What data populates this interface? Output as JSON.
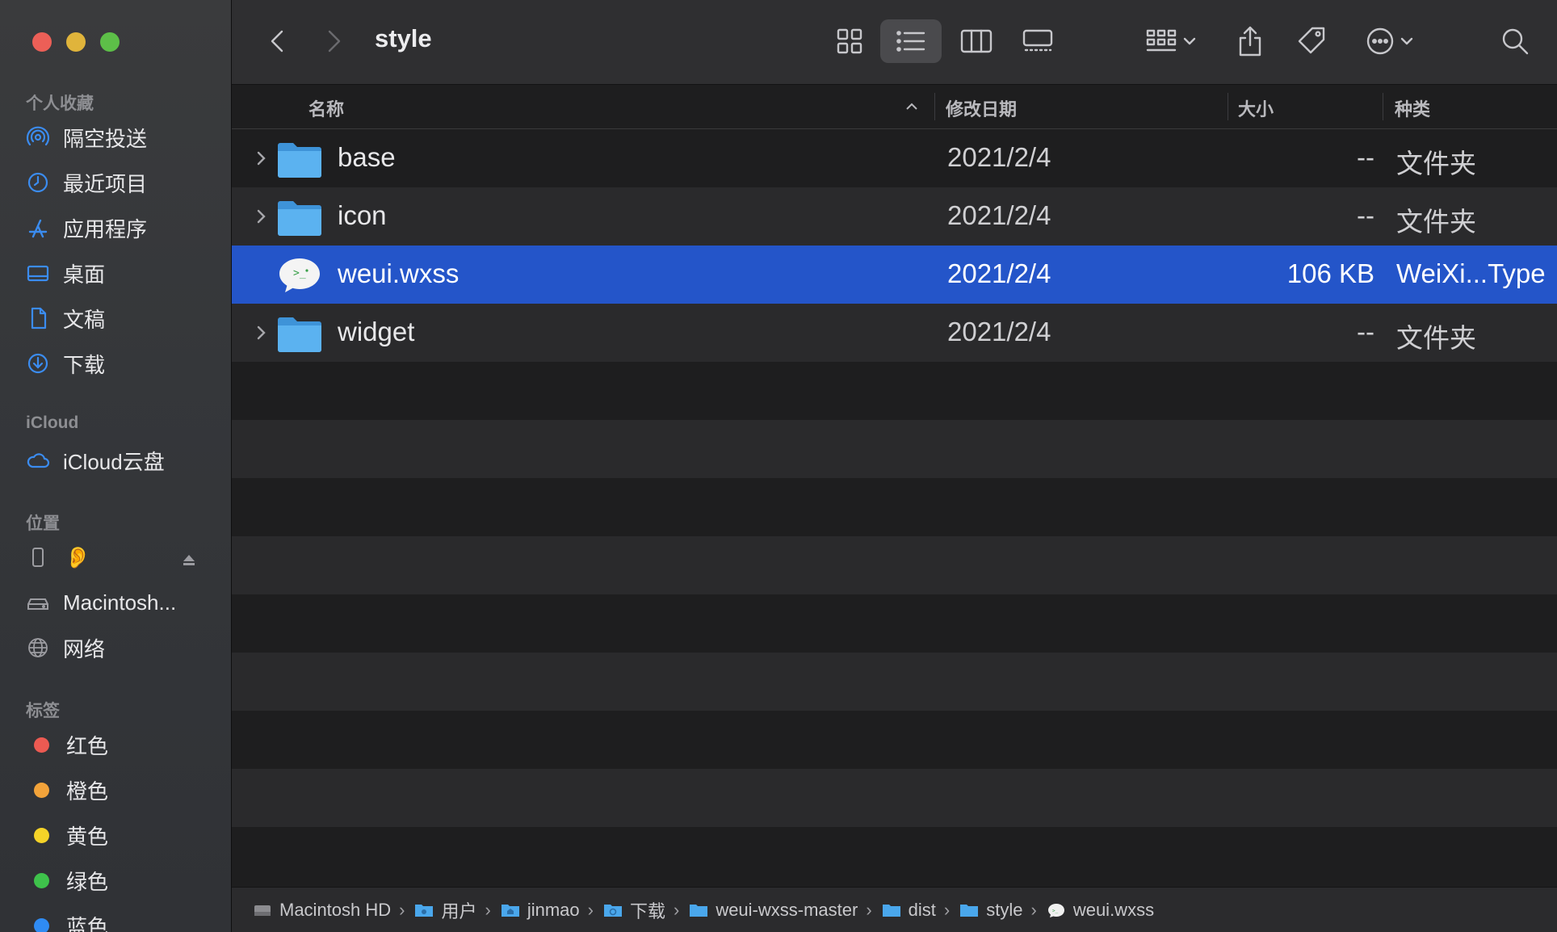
{
  "window": {
    "title": "style"
  },
  "sidebar": {
    "favorites_heading": "个人收藏",
    "favorites": [
      {
        "label": "隔空投送",
        "icon": "airdrop-icon"
      },
      {
        "label": "最近项目",
        "icon": "clock-icon"
      },
      {
        "label": "应用程序",
        "icon": "applications-icon"
      },
      {
        "label": "桌面",
        "icon": "desktop-icon"
      },
      {
        "label": "文稿",
        "icon": "document-icon"
      },
      {
        "label": "下载",
        "icon": "download-icon"
      }
    ],
    "icloud_heading": "iCloud",
    "icloud": [
      {
        "label": "iCloud云盘",
        "icon": "cloud-icon"
      }
    ],
    "locations_heading": "位置",
    "locations": [
      {
        "label": "",
        "icon": "iphone-icon"
      },
      {
        "label": "Macintosh...",
        "icon": "hard-drive-icon"
      },
      {
        "label": "网络",
        "icon": "network-globe-icon"
      }
    ],
    "tags_heading": "标签",
    "tags": [
      {
        "label": "红色",
        "color": "#ec5a52"
      },
      {
        "label": "橙色",
        "color": "#f2a33a"
      },
      {
        "label": "黄色",
        "color": "#f5d328"
      },
      {
        "label": "绿色",
        "color": "#3ec24b"
      },
      {
        "label": "蓝色",
        "color": "#2f8bf3"
      }
    ]
  },
  "columns": {
    "name": "名称",
    "date": "修改日期",
    "size": "大小",
    "kind": "种类"
  },
  "files": [
    {
      "name": "base",
      "date": "2021/2/4",
      "size": "--",
      "kind": "文件夹",
      "type": "folder",
      "selected": false
    },
    {
      "name": "icon",
      "date": "2021/2/4",
      "size": "--",
      "kind": "文件夹",
      "type": "folder",
      "selected": false
    },
    {
      "name": "weui.wxss",
      "date": "2021/2/4",
      "size": "106 KB",
      "kind": "WeiXi...Type",
      "type": "wxss",
      "selected": true
    },
    {
      "name": "widget",
      "date": "2021/2/4",
      "size": "--",
      "kind": "文件夹",
      "type": "folder",
      "selected": false
    }
  ],
  "pathbar": [
    {
      "label": "Macintosh HD",
      "icon": "hard-drive-icon"
    },
    {
      "label": "用户",
      "icon": "folder-icon"
    },
    {
      "label": "jinmao",
      "icon": "home-folder-icon"
    },
    {
      "label": "下载",
      "icon": "downloads-folder-icon"
    },
    {
      "label": "weui-wxss-master",
      "icon": "folder-icon"
    },
    {
      "label": "dist",
      "icon": "folder-icon"
    },
    {
      "label": "style",
      "icon": "folder-icon"
    },
    {
      "label": "weui.wxss",
      "icon": "wechat-file-icon"
    }
  ],
  "colors": {
    "accent": "#2455c9",
    "folder": "#4aa7ec"
  }
}
